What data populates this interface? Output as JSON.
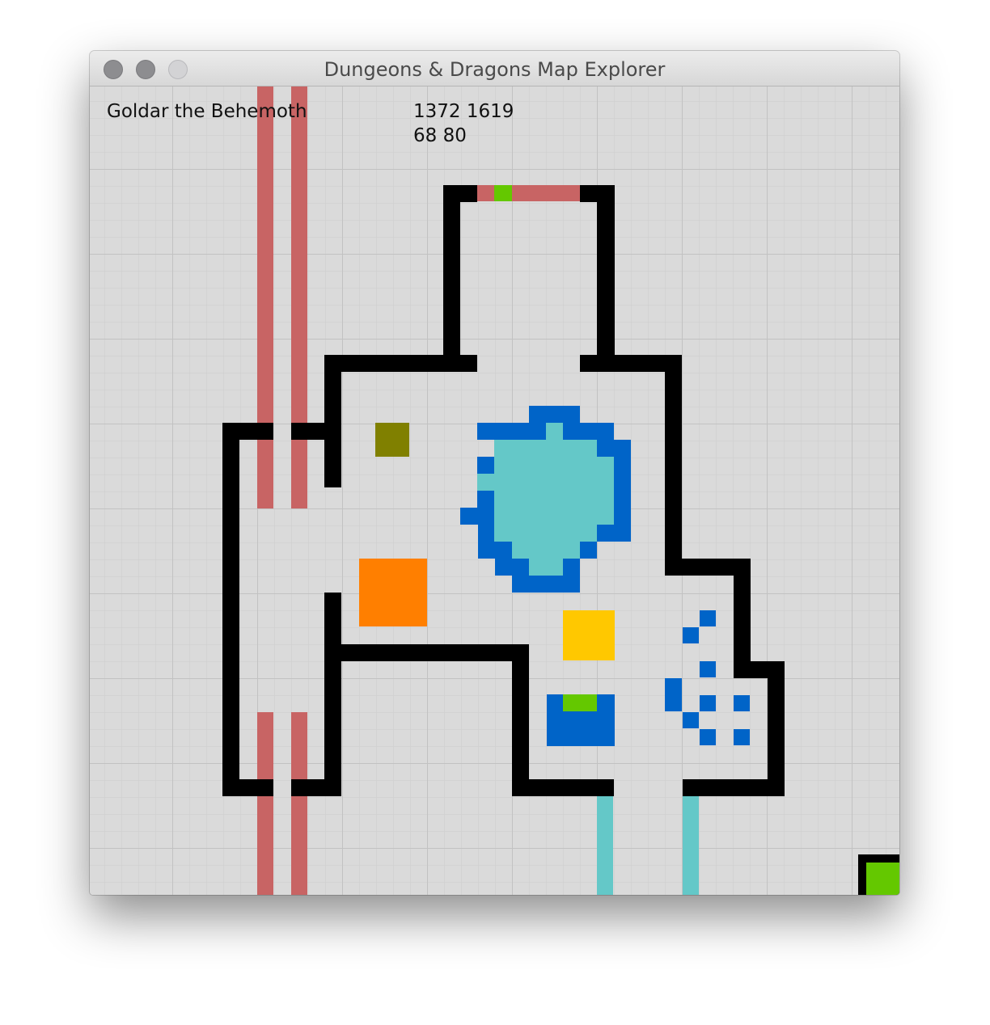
{
  "window": {
    "title": "Dungeons & Dragons Map Explorer"
  },
  "hud": {
    "character_name": "Goldar the Behemoth",
    "coords_line1": "1372 1619",
    "coords_line2": "68 80"
  },
  "colors": {
    "background": "#dadada",
    "grid_line": "#c8c8c8",
    "wall": "#000000",
    "door_red": "#c86464",
    "water_light": "#64c8c8",
    "water_dark": "#0064c8",
    "green": "#64c800",
    "olive": "#808000",
    "orange": "#ff7f00",
    "gold": "#ffc800"
  },
  "icons": {
    "window_close": "close-icon",
    "window_minimize": "minimize-icon",
    "window_zoom": "zoom-icon"
  }
}
